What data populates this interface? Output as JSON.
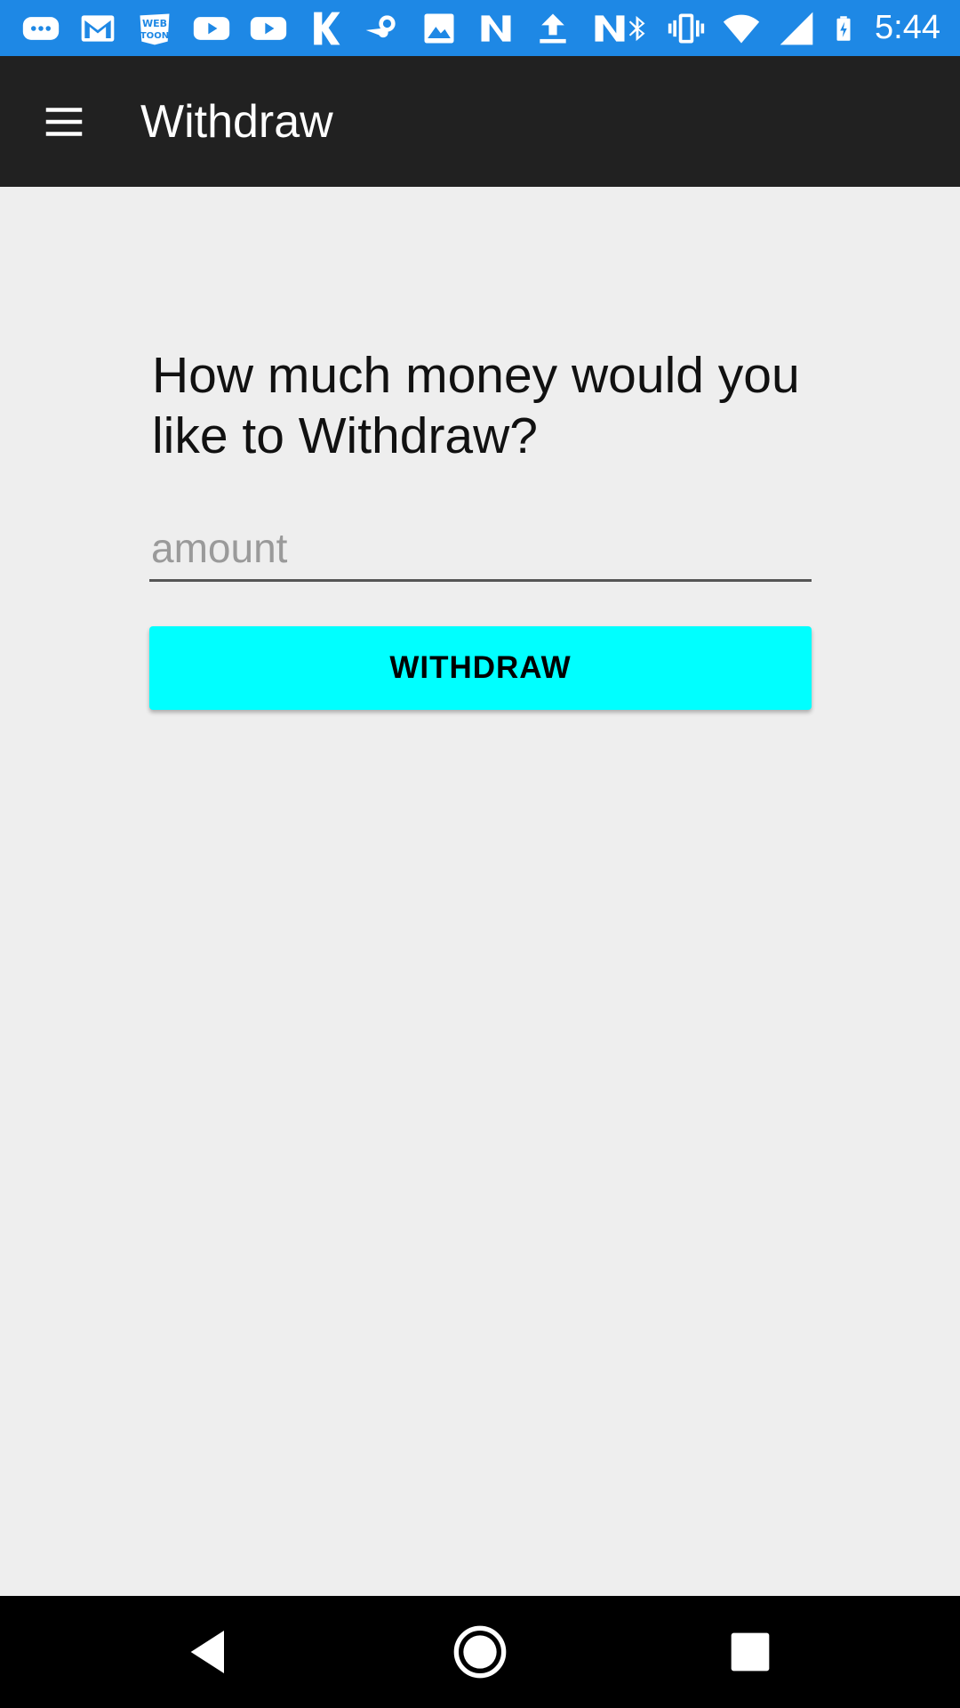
{
  "status_bar": {
    "left_icons": [
      "messages-icon",
      "gmail-icon",
      "webtoon-icon",
      "youtube-icon",
      "youtube-icon",
      "k-app-icon",
      "steam-icon",
      "image-icon",
      "n-app-icon",
      "upload-icon",
      "n-app-icon"
    ],
    "right_icons": [
      "bluetooth-icon",
      "vibrate-icon",
      "wifi-icon",
      "signal-icon",
      "battery-charging-icon"
    ],
    "time": "5:44",
    "color": "#1e88e5"
  },
  "app_bar": {
    "menu_icon": "hamburger-menu-icon",
    "title": "Withdraw",
    "color": "#212121"
  },
  "form": {
    "prompt": "How much money would you like to Withdraw?",
    "amount_value": "",
    "amount_placeholder": "amount",
    "withdraw_label": "WITHDRAW",
    "button_color": "#00ffff"
  },
  "nav_bar": {
    "buttons": [
      "back-icon",
      "home-icon",
      "recents-icon"
    ]
  }
}
